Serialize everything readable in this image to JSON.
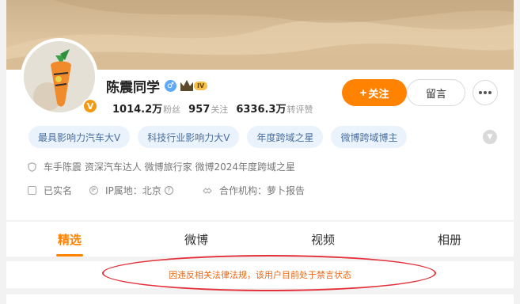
{
  "profile": {
    "name": "陈震同学",
    "gender_symbol": "♂",
    "level_badge": "IV",
    "verified_mark": "V",
    "stats": [
      {
        "value": "1014.2万",
        "label": "粉丝"
      },
      {
        "value": "957",
        "label": "关注"
      },
      {
        "value": "6336.3万",
        "label": "转评赞"
      }
    ]
  },
  "actions": {
    "follow_plus": "+",
    "follow_label": "关注",
    "message_label": "留言"
  },
  "tags": [
    "最具影响力汽车大V",
    "科技行业影响力大V",
    "年度跨域之星",
    "微博跨域博主"
  ],
  "expand_icon": "chevron-down-icon",
  "info": {
    "verification": "车手陈震 资深汽车达人 微博旅行家 微博2024年度跨域之星",
    "real_name": "已实名",
    "ip_location": "IP属地：北京",
    "help_mark": "?",
    "partner": "合作机构：萝卜报告"
  },
  "tabs": [
    "精选",
    "微博",
    "视频",
    "相册"
  ],
  "active_tab": "精选",
  "notice": "因违反相关法律法规，该用户目前处于禁言状态",
  "colors": {
    "accent": "#ff8200",
    "tag_bg": "#eaf3fb",
    "tag_text": "#4a6fa0",
    "notice_text": "#e86a1a",
    "annotation": "#e3303a"
  },
  "icons": [
    "shield-icon",
    "id-card-icon",
    "ip-icon",
    "question-icon",
    "handshake-icon",
    "more-icon",
    "gender-icon",
    "crown-icon"
  ]
}
